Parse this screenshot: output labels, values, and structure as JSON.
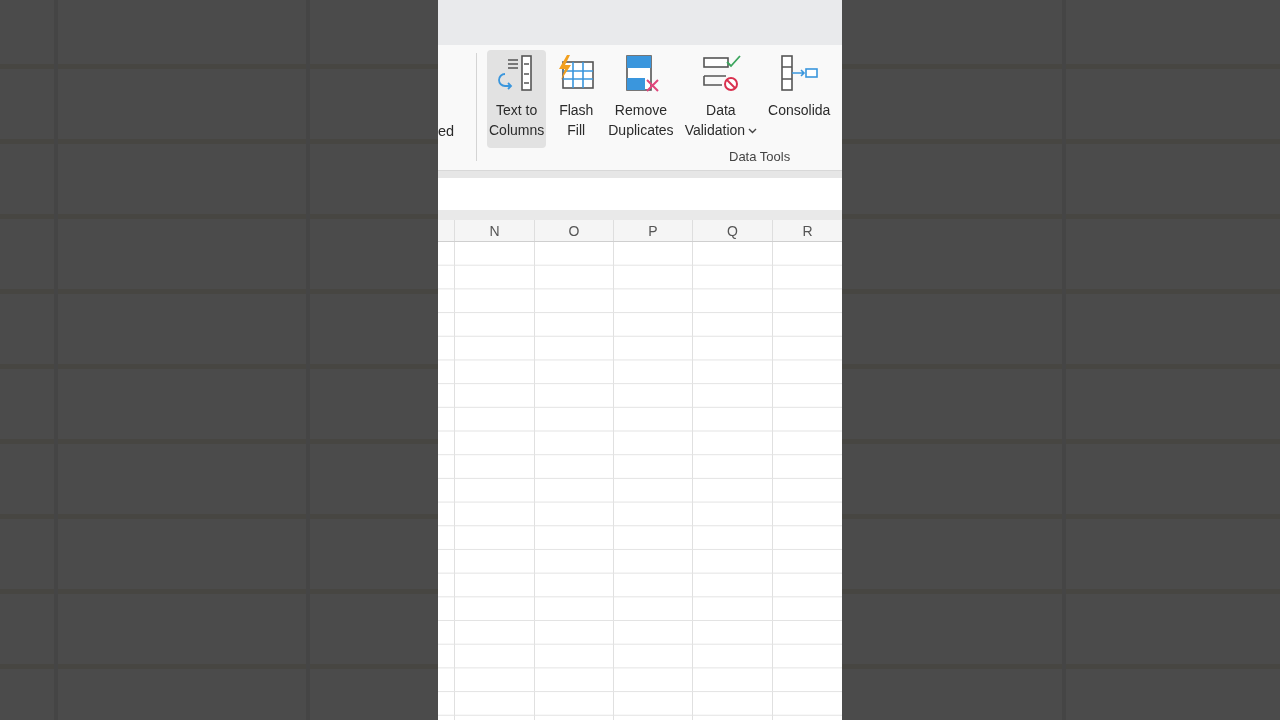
{
  "ribbon": {
    "cut_label": "ed",
    "buttons": [
      {
        "kind": "text-to-columns",
        "lines": [
          "Text to",
          "Columns"
        ],
        "selected": true,
        "dropdown": false
      },
      {
        "kind": "flash-fill",
        "lines": [
          "Flash",
          "Fill"
        ],
        "selected": false,
        "dropdown": false
      },
      {
        "kind": "remove-duplicates",
        "lines": [
          "Remove",
          "Duplicates"
        ],
        "selected": false,
        "dropdown": false
      },
      {
        "kind": "data-validation",
        "lines": [
          "Data",
          "Validation"
        ],
        "selected": false,
        "dropdown": true
      },
      {
        "kind": "consolidate",
        "lines": [
          "Consolida"
        ],
        "selected": false,
        "dropdown": false
      }
    ],
    "group_label": "Data Tools"
  },
  "sheet": {
    "columns": [
      "N",
      "O",
      "P",
      "Q",
      "R"
    ]
  }
}
